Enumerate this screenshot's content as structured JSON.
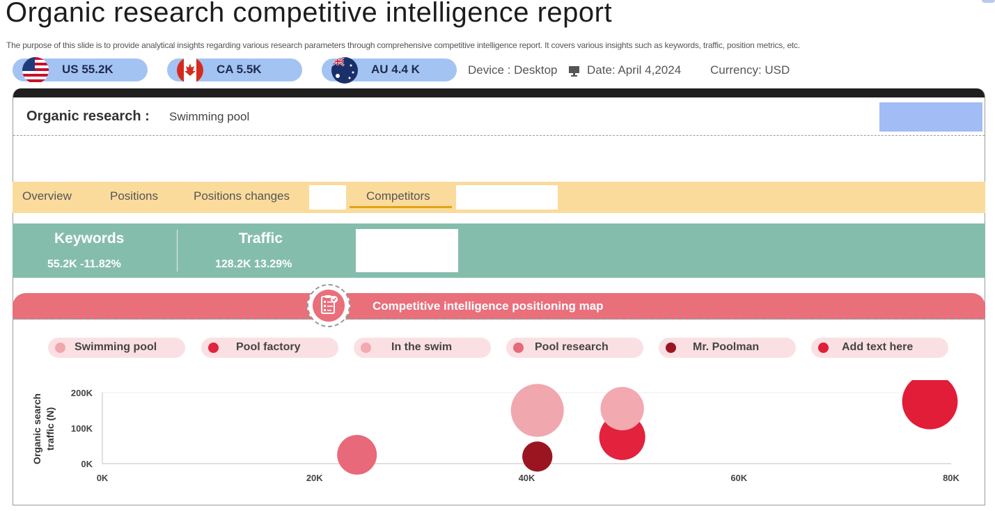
{
  "page": {
    "title": "Organic research competitive intelligence report",
    "subtitle": "The purpose of this slide is to provide analytical insights regarding various research parameters through comprehensive competitive intelligence report. It covers various insights such as keywords, traffic, position metrics, etc."
  },
  "organic": {
    "label": "Organic research :",
    "value": "Swimming pool"
  },
  "countries": [
    {
      "label": "US 55.2K",
      "flag": "us-flag-icon"
    },
    {
      "label": "CA 5.5K",
      "flag": "canada-flag-icon"
    },
    {
      "label": "AU 4.4 K",
      "flag": "australia-flag-icon"
    }
  ],
  "meta": {
    "device": "Device : Desktop",
    "date": "Date: April 4,2024",
    "currency": "Currency:  USD"
  },
  "tabs": [
    "Overview",
    "Positions",
    "Positions changes",
    "Competitors"
  ],
  "active_tab": "Competitors",
  "metrics": {
    "keywords_title": "Keywords",
    "keywords_value": "55.2K -11.82%",
    "traffic_title": "Traffic",
    "traffic_value": "128.2K 13.29%"
  },
  "map": {
    "title": "Competitive intelligence positioning map",
    "icon": "checklist-icon"
  },
  "colors": {
    "accent_pink": "#e96f7b",
    "tab_bar": "#fbdb9c",
    "metric_bar": "#85bdad",
    "country_pill": "#a3c3f3"
  },
  "chart_data": {
    "type": "scatter",
    "bubble": true,
    "ylabel": "Organic search traffic (N)",
    "xlabel": "",
    "xlim": [
      0,
      80000
    ],
    "ylim": [
      0,
      200000
    ],
    "x_ticks": [
      "0K",
      "20K",
      "40K",
      "60K",
      "80K"
    ],
    "y_ticks": [
      "0K",
      "100K",
      "200K"
    ],
    "series": [
      {
        "name": "Swimming pool",
        "color": "#f0a7ae",
        "points": [
          {
            "x": 41000,
            "y": 150000,
            "size": 1.0
          }
        ]
      },
      {
        "name": "Pool factory",
        "color": "#e3223d",
        "points": [
          {
            "x": 49000,
            "y": 75000,
            "size": 0.87
          }
        ]
      },
      {
        "name": "In the swim",
        "color": "#f2a9b0",
        "points": [
          {
            "x": 49000,
            "y": 155000,
            "size": 0.82
          }
        ]
      },
      {
        "name": "Pool research",
        "color": "#e8697a",
        "points": [
          {
            "x": 24000,
            "y": 25000,
            "size": 0.75
          }
        ]
      },
      {
        "name": "Mr. Poolman",
        "color": "#9b1521",
        "points": [
          {
            "x": 41000,
            "y": 20000,
            "size": 0.57
          }
        ]
      },
      {
        "name": "Add text here",
        "color": "#e11d38",
        "points": [
          {
            "x": 78000,
            "y": 175000,
            "size": 1.05
          }
        ]
      }
    ]
  }
}
